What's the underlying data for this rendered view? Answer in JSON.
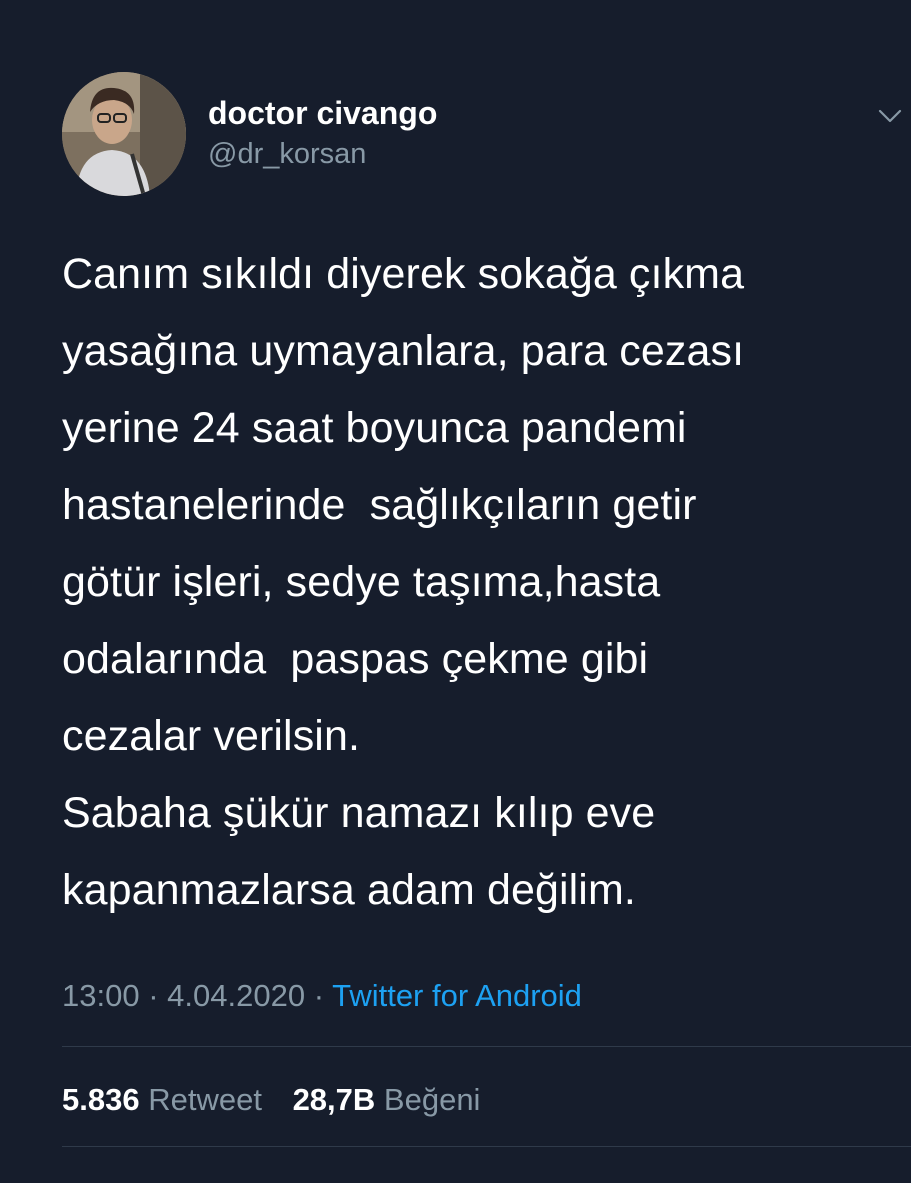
{
  "user": {
    "display_name": "doctor civango",
    "handle": "@dr_korsan",
    "avatar_icon": "profile-photo"
  },
  "menu": {
    "icon": "chevron-down-icon"
  },
  "tweet": {
    "text": "Canım sıkıldı diyerek sokağa çıkma\nyasağına uymayanlara, para cezası\nyerine 24 saat boyunca pandemi\nhastanelerinde  sağlıkçıların getir\ngötür işleri, sedye taşıma,hasta\nodalarında  paspas çekme gibi\ncezalar verilsin.\nSabaha şükür namazı kılıp eve\nkapanmazlarsa adam değilim.",
    "time": "13:00",
    "separator": "·",
    "date": "4.04.2020",
    "source": "Twitter for Android"
  },
  "stats": {
    "retweets": "5.836",
    "retweets_label": "Retweet",
    "likes": "28,7B",
    "likes_label": "Beğeni"
  },
  "colors": {
    "background": "#161d2c",
    "secondary_text": "#8899a6",
    "link": "#1da1f2",
    "divider": "#2f3a4a"
  }
}
